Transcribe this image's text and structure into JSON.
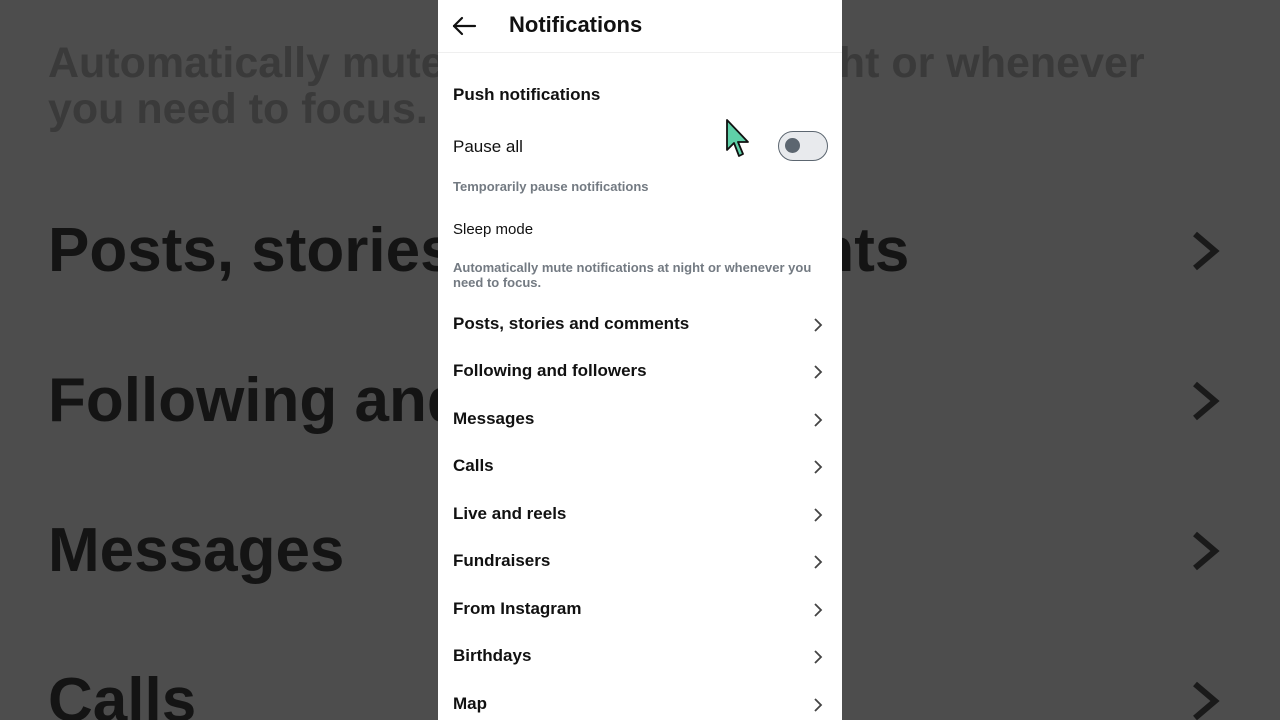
{
  "background": {
    "description": "Automatically mute notifications at night or whenever you need to focus.",
    "rows": [
      "Posts, stories and comments",
      "Following and followers",
      "Messages",
      "Calls"
    ]
  },
  "header": {
    "title": "Notifications",
    "back_icon": "arrow-left-icon"
  },
  "push": {
    "heading": "Push notifications",
    "pause_all_label": "Pause all",
    "pause_all_enabled": false,
    "pause_all_description": "Temporarily pause notifications",
    "sleep_mode_label": "Sleep mode",
    "sleep_mode_description": "Automatically mute notifications at night or whenever you need to focus."
  },
  "categories": [
    {
      "label": "Posts, stories and comments"
    },
    {
      "label": "Following and followers"
    },
    {
      "label": "Messages"
    },
    {
      "label": "Calls"
    },
    {
      "label": "Live and reels"
    },
    {
      "label": "Fundraisers"
    },
    {
      "label": "From Instagram"
    },
    {
      "label": "Birthdays"
    },
    {
      "label": "Map"
    }
  ],
  "colors": {
    "cursor": "#5fd0a8",
    "toggle_off": "#5c6670",
    "muted_text": "#737a82"
  }
}
